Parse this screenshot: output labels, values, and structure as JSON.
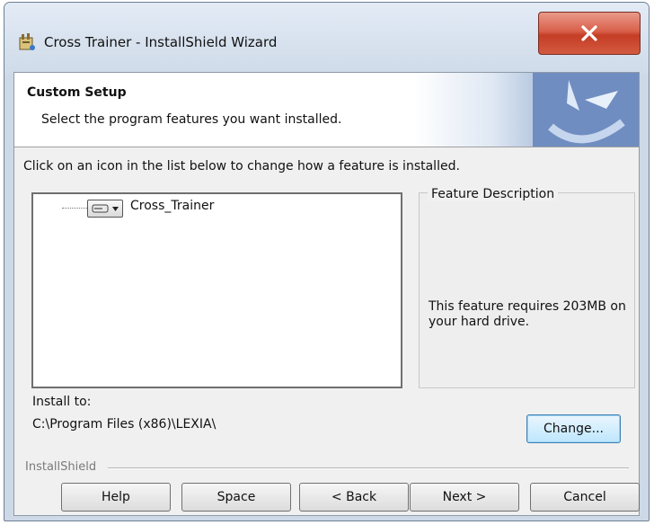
{
  "window": {
    "title": "Cross Trainer - InstallShield Wizard",
    "icons": {
      "app": "installer-icon",
      "close": "close-icon"
    }
  },
  "banner": {
    "title": "Custom Setup",
    "subtitle": "Select the program features you want installed."
  },
  "instruction": "Click on an icon in the list below to change how a feature is installed.",
  "features": [
    {
      "label": "Cross_Trainer",
      "icon": "hard-drive-icon"
    }
  ],
  "description": {
    "title": "Feature Description",
    "text": "This feature requires 203MB on your hard drive."
  },
  "install": {
    "label": "Install to:",
    "path": "C:\\Program Files (x86)\\LEXIA\\"
  },
  "buttons": {
    "change": "Change...",
    "help": "Help",
    "space": "Space",
    "back": "< Back",
    "next": "Next >",
    "cancel": "Cancel"
  },
  "brand": "InstallShield",
  "colors": {
    "close_button": "#c53d25",
    "banner_accent": "#6f8dc0",
    "default_button": "#bee6fd"
  }
}
